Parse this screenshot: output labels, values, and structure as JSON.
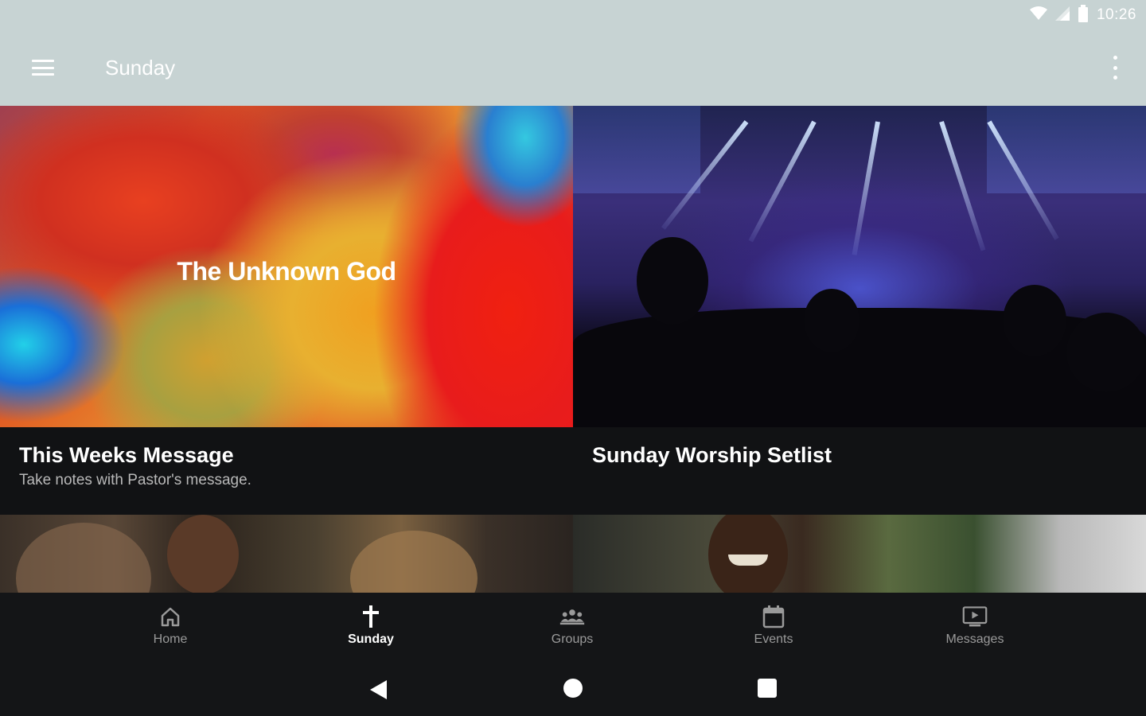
{
  "status_bar": {
    "time": "10:26",
    "icons": [
      "wifi-icon",
      "signal-icon",
      "battery-icon"
    ]
  },
  "app_bar": {
    "title": "Sunday",
    "menu_icon": "hamburger-menu-icon",
    "overflow_icon": "more-vertical-icon"
  },
  "cards": [
    {
      "title": "This Weeks Message",
      "subtitle": "Take notes with Pastor's message.",
      "image_text": "The Unknown God"
    },
    {
      "title": "Sunday Worship Setlist",
      "subtitle": ""
    }
  ],
  "bottom_nav": {
    "items": [
      {
        "label": "Home",
        "icon": "home-icon",
        "active": false
      },
      {
        "label": "Sunday",
        "icon": "cross-icon",
        "active": true
      },
      {
        "label": "Groups",
        "icon": "groups-icon",
        "active": false
      },
      {
        "label": "Events",
        "icon": "calendar-icon",
        "active": false
      },
      {
        "label": "Messages",
        "icon": "tv-play-icon",
        "active": false
      }
    ]
  },
  "system_nav": [
    "back-icon",
    "home-circle-icon",
    "recents-icon"
  ],
  "colors": {
    "app_bar": "#c7d3d3",
    "background": "#111214",
    "nav_active": "#ffffff",
    "nav_inactive": "#9a9a9a"
  }
}
